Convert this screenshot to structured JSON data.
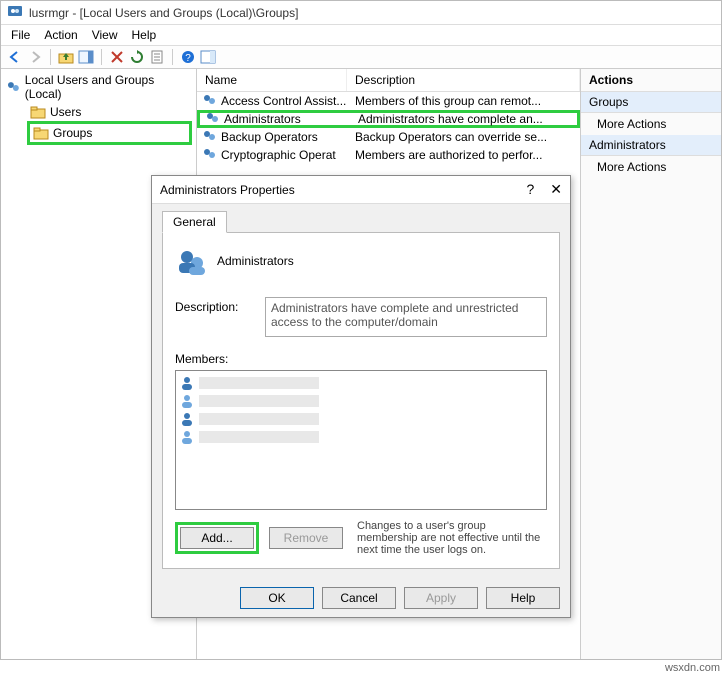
{
  "window": {
    "title": "lusrmgr - [Local Users and Groups (Local)\\Groups]"
  },
  "menubar": [
    "File",
    "Action",
    "View",
    "Help"
  ],
  "tree": {
    "root": "Local Users and Groups (Local)",
    "children": [
      {
        "label": "Users",
        "selected": false,
        "highlight": false
      },
      {
        "label": "Groups",
        "selected": true,
        "highlight": true
      }
    ]
  },
  "list": {
    "headers": {
      "name": "Name",
      "desc": "Description"
    },
    "rows": [
      {
        "name": "Access Control Assist...",
        "desc": "Members of this group can remot...",
        "highlight": false
      },
      {
        "name": "Administrators",
        "desc": "Administrators have complete an...",
        "highlight": true
      },
      {
        "name": "Backup Operators",
        "desc": "Backup Operators can override se...",
        "highlight": false
      },
      {
        "name": "Cryptographic Operat",
        "desc": "Members are authorized to perfor...",
        "highlight": false
      }
    ]
  },
  "actions": {
    "heading": "Actions",
    "group1": "Groups",
    "more1": "More Actions",
    "group2": "Administrators",
    "more2": "More Actions"
  },
  "dialog": {
    "title": "Administrators Properties",
    "tab": "General",
    "group_name": "Administrators",
    "desc_label": "Description:",
    "desc_value": "Administrators have complete and unrestricted access to the computer/domain",
    "members_label": "Members:",
    "add": "Add...",
    "remove": "Remove",
    "note": "Changes to a user's group membership are not effective until the next time the user logs on.",
    "ok": "OK",
    "cancel": "Cancel",
    "apply": "Apply",
    "help": "Help"
  },
  "watermark": "wsxdn.com"
}
